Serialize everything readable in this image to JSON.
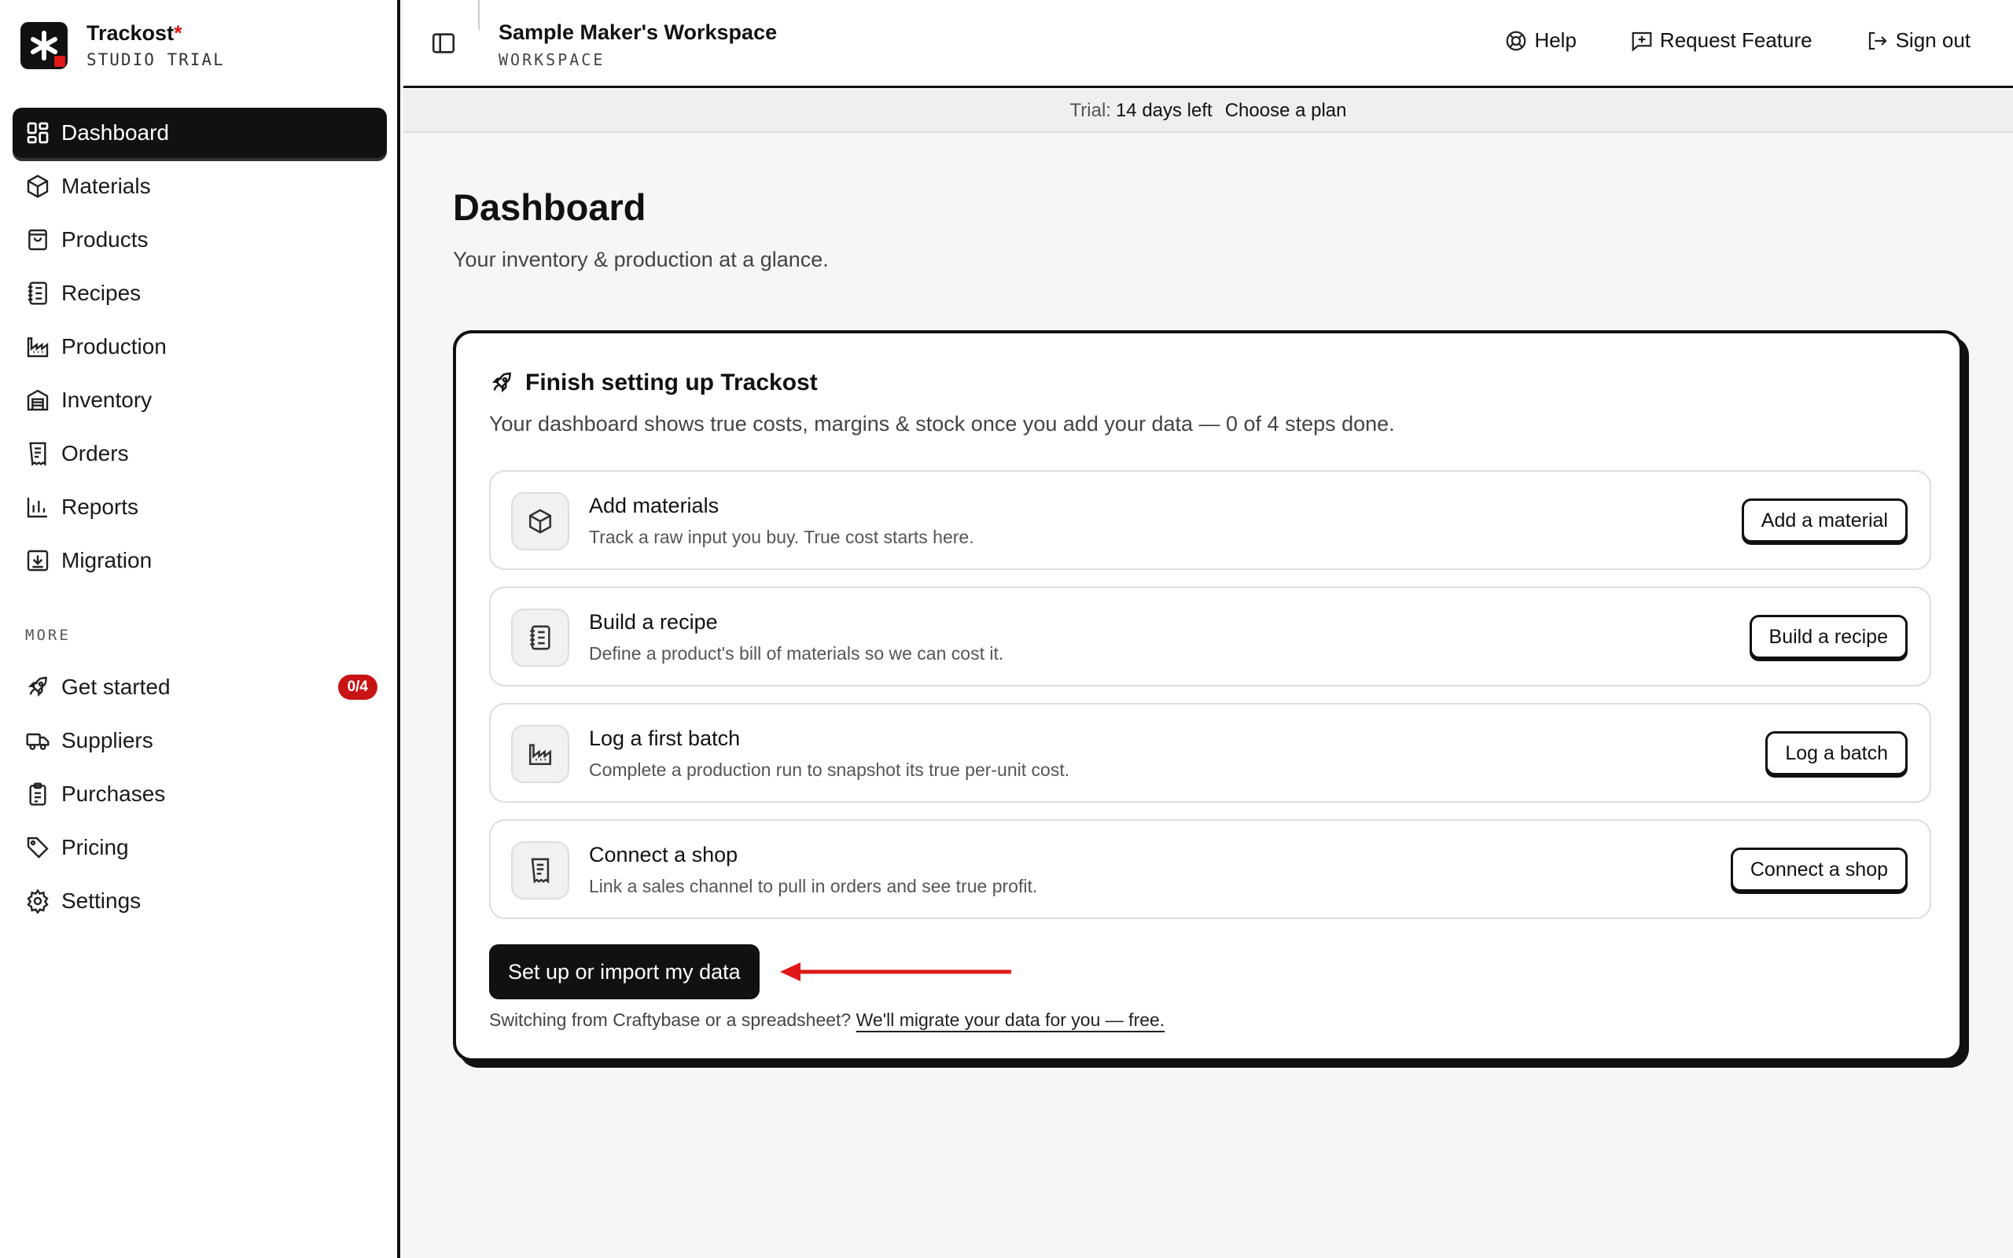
{
  "brand": {
    "name": "Trackost",
    "star": "*",
    "plan": "STUDIO TRIAL"
  },
  "sidebar": {
    "items": [
      {
        "label": "Dashboard",
        "icon": "grid-icon",
        "active": true
      },
      {
        "label": "Materials",
        "icon": "box-icon"
      },
      {
        "label": "Products",
        "icon": "bag-icon"
      },
      {
        "label": "Recipes",
        "icon": "recipe-book-icon"
      },
      {
        "label": "Production",
        "icon": "factory-icon"
      },
      {
        "label": "Inventory",
        "icon": "warehouse-icon"
      },
      {
        "label": "Orders",
        "icon": "receipt-icon"
      },
      {
        "label": "Reports",
        "icon": "bar-chart-icon"
      },
      {
        "label": "Migration",
        "icon": "import-icon"
      }
    ],
    "section_label": "MORE",
    "more_items": [
      {
        "label": "Get started",
        "icon": "rocket-icon",
        "badge": "0/4"
      },
      {
        "label": "Suppliers",
        "icon": "truck-icon"
      },
      {
        "label": "Purchases",
        "icon": "clipboard-icon"
      },
      {
        "label": "Pricing",
        "icon": "tag-icon"
      },
      {
        "label": "Settings",
        "icon": "gear-icon"
      }
    ]
  },
  "header": {
    "workspace_title": "Sample Maker's Workspace",
    "workspace_sub": "WORKSPACE",
    "help": "Help",
    "request_feature": "Request Feature",
    "sign_out": "Sign out"
  },
  "trial": {
    "label": "Trial:",
    "days": "14 days left",
    "cta": "Choose a plan"
  },
  "page": {
    "title": "Dashboard",
    "subtitle": "Your inventory & production at a glance."
  },
  "setup": {
    "title": "Finish setting up Trackost",
    "subtitle": "Your dashboard shows true costs, margins & stock once you add your data — 0 of 4 steps done.",
    "steps": [
      {
        "title": "Add materials",
        "desc": "Track a raw input you buy. True cost starts here.",
        "button": "Add a material",
        "icon": "box-icon"
      },
      {
        "title": "Build a recipe",
        "desc": "Define a product's bill of materials so we can cost it.",
        "button": "Build a recipe",
        "icon": "recipe-book-icon"
      },
      {
        "title": "Log a first batch",
        "desc": "Complete a production run to snapshot its true per-unit cost.",
        "button": "Log a batch",
        "icon": "factory-icon"
      },
      {
        "title": "Connect a shop",
        "desc": "Link a sales channel to pull in orders and see true profit.",
        "button": "Connect a shop",
        "icon": "receipt-icon"
      }
    ],
    "primary_button": "Set up or import my data",
    "migrate_text": "Switching from Craftybase or a spreadsheet?",
    "migrate_link": "We'll migrate your data for you — free."
  },
  "colors": {
    "accent_red": "#e0181a",
    "badge_red": "#c81414",
    "ink": "#111111"
  }
}
